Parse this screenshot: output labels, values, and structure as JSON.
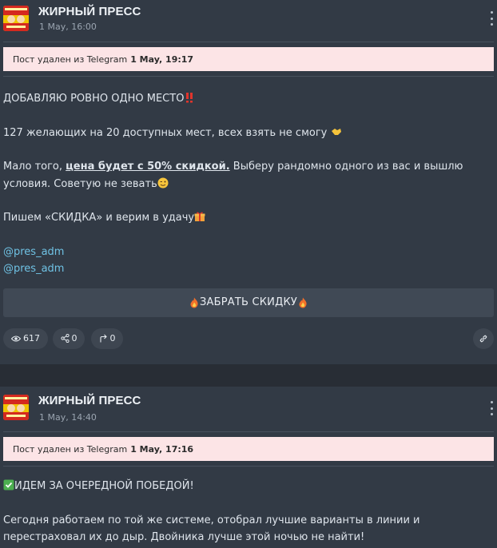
{
  "posts": [
    {
      "channel": {
        "name": "ЖИРНЫЙ ПРЕСС",
        "avatar_text": "ЖИРНЫЙ ПРЕСС"
      },
      "time": "1 May, 16:00",
      "deleted": {
        "text": "Пост удален из Telegram",
        "date": "1 May, 19:17"
      },
      "headline": "ДОБАВЛЯЮ РОВНО ОДНО МЕСТО",
      "para1": "127 желающих на 20 доступных мест, всех взять не смогу",
      "para2_a": "Мало того,",
      "para2_link": "цена будет с 50% скидкой.",
      "para2_b": "Выберу рандомно одного из вас и вышлю условия. Советую не зевать",
      "para3": "Пишем «СКИДКА» и верим в удачу",
      "mention1": "@pres_adm",
      "mention2": "@pres_adm",
      "button": "ЗАБРАТЬ СКИДКУ",
      "views": "617",
      "shares": "0",
      "forwards": "0"
    },
    {
      "channel": {
        "name": "ЖИРНЫЙ ПРЕСС",
        "avatar_text": "ЖИРНЫЙ ПРЕСС"
      },
      "time": "1 May, 14:40",
      "deleted": {
        "text": "Пост удален из Telegram",
        "date": "1 May, 17:16"
      },
      "headline": "ИДЕМ ЗА ОЧЕРЕДНОЙ ПОБЕДОЙ!",
      "para1": "Сегодня работаем по той же системе, отобрал лучшие варианты в линии и перестраховал их до дыр. Двойника лучше этой ночью не найти!"
    }
  ],
  "icons": {
    "menu": "more-vertical-icon",
    "views": "eye-icon",
    "shares": "share-icon",
    "forwards": "forward-icon",
    "link": "link-icon",
    "double_exclaim": "double-exclamation-emoji",
    "handshake": "handshake-emoji",
    "wink": "winking-face-emoji",
    "gift": "gift-emoji",
    "fire": "fire-emoji",
    "check": "check-mark-emoji"
  },
  "colors": {
    "page_bg": "#2b313b",
    "card_bg": "#323a45",
    "banner_bg": "#fce4e6",
    "link": "#6fc2e4",
    "button_bg": "#404955"
  }
}
